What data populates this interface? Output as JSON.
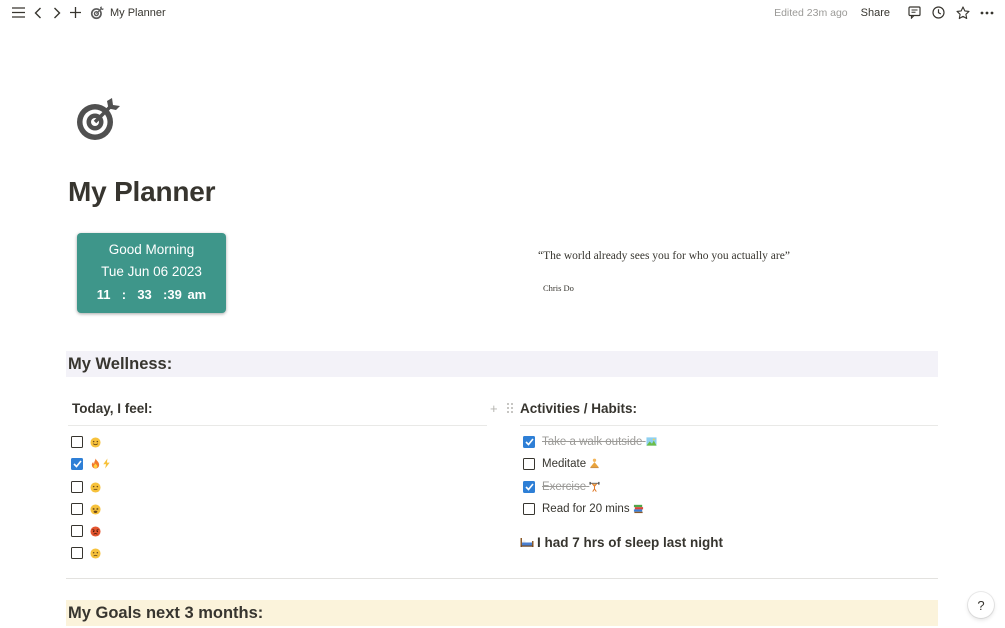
{
  "topbar": {
    "title": "My Planner",
    "edited": "Edited 23m ago",
    "share_label": "Share"
  },
  "page": {
    "title": "My Planner",
    "icon": "target-icon"
  },
  "clock": {
    "greeting": "Good Morning",
    "date": "Tue Jun 06 2023",
    "hours": "11",
    "minutes": "33",
    "seconds": "39",
    "period": "am",
    "color": "#3e968a"
  },
  "quote": {
    "text": "“The world already sees you for who you actually are”",
    "author": "Chris Do"
  },
  "wellness": {
    "header": "My Wellness:",
    "header_bg": "#f3f2f8",
    "feel": {
      "header": "Today, I feel:",
      "items": [
        {
          "emoji": "smile-emoji",
          "checked": false
        },
        {
          "emoji": "fire-lightning-emoji",
          "checked": true
        },
        {
          "emoji": "neutral-emoji",
          "checked": false
        },
        {
          "emoji": "tired-emoji",
          "checked": false
        },
        {
          "emoji": "angry-emoji",
          "checked": false
        },
        {
          "emoji": "sad-emoji",
          "checked": false
        }
      ]
    },
    "habits": {
      "header": "Activities / Habits:",
      "items": [
        {
          "label": "Take a walk outside",
          "emoji": "landscape-emoji",
          "checked": true
        },
        {
          "label": "Meditate",
          "emoji": "meditate-emoji",
          "checked": false
        },
        {
          "label": "Exercise",
          "emoji": "weightlifter-emoji",
          "checked": true
        },
        {
          "label": "Read for 20 mins",
          "emoji": "books-emoji",
          "checked": false
        }
      ]
    },
    "sleep": "I had 7 hrs of sleep last night"
  },
  "goals": {
    "header": "My Goals next 3 months:",
    "header_bg": "#fbf3db"
  },
  "help_label": "?"
}
